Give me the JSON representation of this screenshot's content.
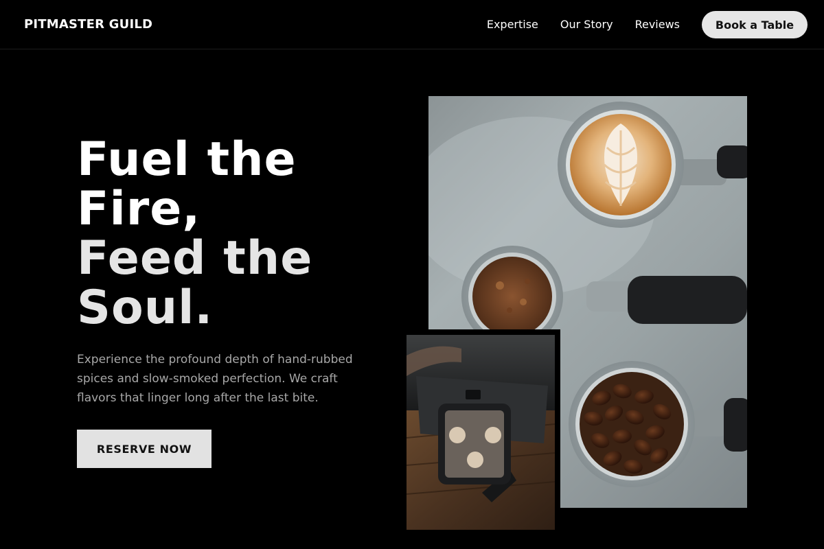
{
  "header": {
    "brand": "PITMASTER GUILD",
    "nav": [
      {
        "label": "Expertise"
      },
      {
        "label": "Our Story"
      },
      {
        "label": "Reviews"
      }
    ],
    "cta_label": "Book a Table"
  },
  "hero": {
    "title_lines": [
      "Fuel the",
      "Fire,",
      "Feed the",
      "Soul."
    ],
    "description": "Experience the profound depth of hand-rubbed spices and slow-smoked perfection. We craft flavors that linger long after the last bite.",
    "button_label": "RESERVE NOW"
  },
  "colors": {
    "background": "#000000",
    "cta_bg": "#e6e6e6",
    "text_primary": "#ffffff",
    "text_muted": "#a8a8a8"
  }
}
